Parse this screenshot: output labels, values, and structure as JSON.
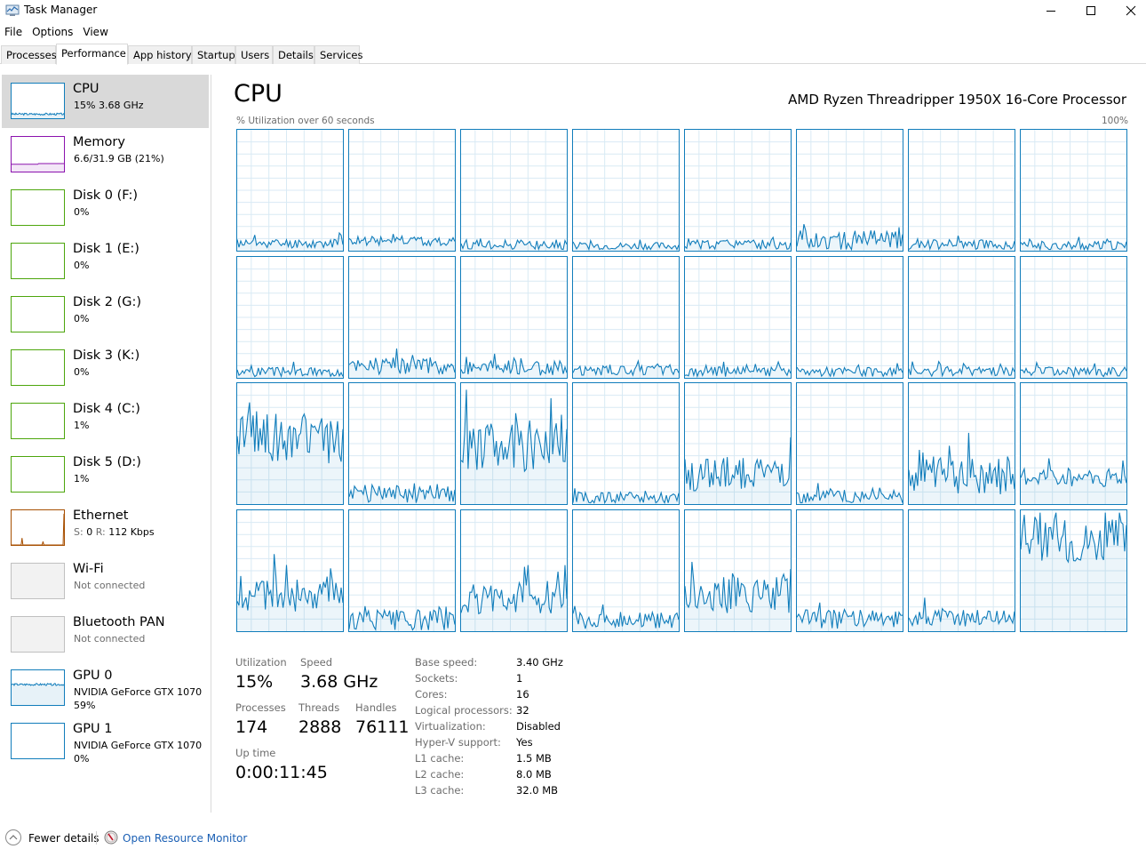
{
  "window": {
    "title": "Task Manager",
    "controls": {
      "minimize": "minimize-icon",
      "maximize": "maximize-icon",
      "close": "close-icon"
    }
  },
  "menu": [
    "File",
    "Options",
    "View"
  ],
  "tabs": [
    {
      "label": "Processes",
      "active": false
    },
    {
      "label": "Performance",
      "active": true
    },
    {
      "label": "App history",
      "active": false
    },
    {
      "label": "Startup",
      "active": false
    },
    {
      "label": "Users",
      "active": false
    },
    {
      "label": "Details",
      "active": false
    },
    {
      "label": "Services",
      "active": false
    }
  ],
  "colors": {
    "cpu": "#117dbb",
    "memory": "#8b12ae",
    "disk": "#4da60c",
    "ethernet": "#a74f01",
    "gpu": "#117dbb",
    "inactive": "#c0c0c0",
    "selected_bg": "#d9d9d9",
    "link": "#1a5fb4"
  },
  "sidebar": [
    {
      "title": "CPU",
      "sub": "15% 3.68 GHz",
      "kind": "cpu",
      "selected": true,
      "level": 0.12
    },
    {
      "title": "Memory",
      "sub": "6.6/31.9 GB (21%)",
      "kind": "memory",
      "selected": false,
      "level": 0.21
    },
    {
      "title": "Disk 0 (F:)",
      "sub": "0%",
      "kind": "disk",
      "selected": false,
      "level": 0
    },
    {
      "title": "Disk 1 (E:)",
      "sub": "0%",
      "kind": "disk",
      "selected": false,
      "level": 0
    },
    {
      "title": "Disk 2 (G:)",
      "sub": "0%",
      "kind": "disk",
      "selected": false,
      "level": 0
    },
    {
      "title": "Disk 3 (K:)",
      "sub": "0%",
      "kind": "disk",
      "selected": false,
      "level": 0
    },
    {
      "title": "Disk 4 (C:)",
      "sub": "1%",
      "kind": "disk",
      "selected": false,
      "level": 0
    },
    {
      "title": "Disk 5 (D:)",
      "sub": "1%",
      "kind": "disk",
      "selected": false,
      "level": 0
    },
    {
      "title": "Ethernet",
      "sub_send_label": "S:",
      "sub_send": "0",
      "sub_recv_label": "R:",
      "sub_recv": "112 Kbps",
      "kind": "ethernet",
      "selected": false,
      "level": 0
    },
    {
      "title": "Wi-Fi",
      "sub": "Not connected",
      "kind": "inactive",
      "selected": false
    },
    {
      "title": "Bluetooth PAN",
      "sub": "Not connected",
      "kind": "inactive",
      "selected": false
    },
    {
      "title": "GPU 0",
      "sub": "NVIDIA GeForce GTX 1070",
      "sub2": "59%",
      "kind": "gpu",
      "selected": false,
      "level": 0.59
    },
    {
      "title": "GPU 1",
      "sub": "NVIDIA GeForce GTX 1070",
      "sub2": "0%",
      "kind": "gpu",
      "selected": false,
      "level": 0
    }
  ],
  "main": {
    "title": "CPU",
    "processor": "AMD Ryzen Threadripper 1950X 16-Core Processor",
    "graph_caption": "% Utilization over 60 seconds",
    "graph_max": "100%",
    "logical_processor_graphs": [
      {
        "avg": 0.06,
        "var": 0.04
      },
      {
        "avg": 0.08,
        "var": 0.04
      },
      {
        "avg": 0.05,
        "var": 0.04
      },
      {
        "avg": 0.04,
        "var": 0.03
      },
      {
        "avg": 0.05,
        "var": 0.04
      },
      {
        "avg": 0.09,
        "var": 0.08
      },
      {
        "avg": 0.05,
        "var": 0.04
      },
      {
        "avg": 0.04,
        "var": 0.04
      },
      {
        "avg": 0.05,
        "var": 0.04
      },
      {
        "avg": 0.1,
        "var": 0.07
      },
      {
        "avg": 0.08,
        "var": 0.06
      },
      {
        "avg": 0.06,
        "var": 0.04
      },
      {
        "avg": 0.05,
        "var": 0.04
      },
      {
        "avg": 0.05,
        "var": 0.04
      },
      {
        "avg": 0.05,
        "var": 0.04
      },
      {
        "avg": 0.05,
        "var": 0.04
      },
      {
        "avg": 0.55,
        "var": 0.22
      },
      {
        "avg": 0.08,
        "var": 0.08
      },
      {
        "avg": 0.48,
        "var": 0.22
      },
      {
        "avg": 0.05,
        "var": 0.05
      },
      {
        "avg": 0.25,
        "var": 0.14
      },
      {
        "avg": 0.06,
        "var": 0.06
      },
      {
        "avg": 0.24,
        "var": 0.16
      },
      {
        "avg": 0.22,
        "var": 0.08
      },
      {
        "avg": 0.3,
        "var": 0.16
      },
      {
        "avg": 0.08,
        "var": 0.1
      },
      {
        "avg": 0.28,
        "var": 0.14
      },
      {
        "avg": 0.09,
        "var": 0.07
      },
      {
        "avg": 0.3,
        "var": 0.15
      },
      {
        "avg": 0.1,
        "var": 0.08
      },
      {
        "avg": 0.12,
        "var": 0.08
      },
      {
        "avg": 0.75,
        "var": 0.18
      }
    ]
  },
  "stats": {
    "utilization_label": "Utilization",
    "utilization": "15%",
    "speed_label": "Speed",
    "speed": "3.68 GHz",
    "processes_label": "Processes",
    "processes": "174",
    "threads_label": "Threads",
    "threads": "2888",
    "handles_label": "Handles",
    "handles": "76111",
    "uptime_label": "Up time",
    "uptime": "0:00:11:45"
  },
  "specs": [
    {
      "label": "Base speed:",
      "value": "3.40 GHz"
    },
    {
      "label": "Sockets:",
      "value": "1"
    },
    {
      "label": "Cores:",
      "value": "16"
    },
    {
      "label": "Logical processors:",
      "value": "32"
    },
    {
      "label": "Virtualization:",
      "value": "Disabled"
    },
    {
      "label": "Hyper-V support:",
      "value": "Yes"
    },
    {
      "label": "L1 cache:",
      "value": "1.5 MB"
    },
    {
      "label": "L2 cache:",
      "value": "8.0 MB"
    },
    {
      "label": "L3 cache:",
      "value": "32.0 MB"
    }
  ],
  "footer": {
    "fewer_details": "Fewer details",
    "open_resource_monitor": "Open Resource Monitor"
  }
}
